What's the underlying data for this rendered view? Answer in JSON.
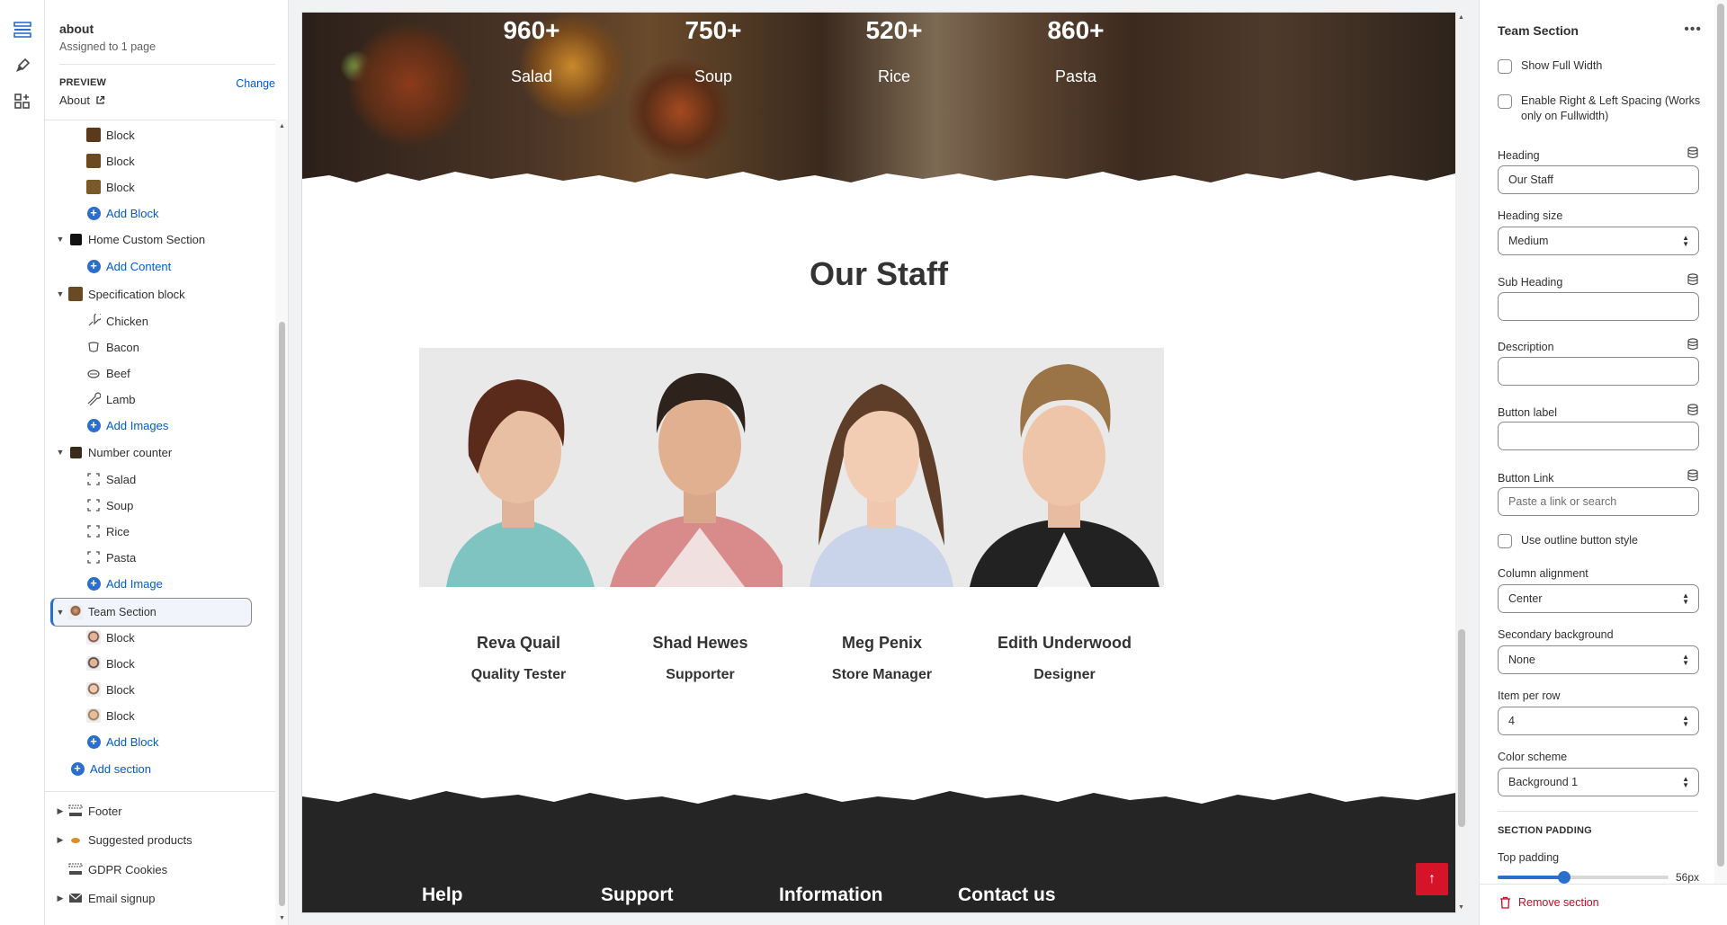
{
  "template": {
    "name": "about",
    "assigned": "Assigned to 1 page"
  },
  "preview_info": {
    "label": "PREVIEW",
    "change": "Change",
    "page": "About"
  },
  "tree": {
    "block_label": "Block",
    "add_block": "Add Block",
    "home_custom": "Home Custom Section",
    "add_content": "Add Content",
    "specification": "Specification block",
    "spec_items": [
      "Chicken",
      "Bacon",
      "Beef",
      "Lamb"
    ],
    "add_images": "Add Images",
    "number_counter": "Number counter",
    "counter_items": [
      "Salad",
      "Soup",
      "Rice",
      "Pasta"
    ],
    "add_image": "Add Image",
    "team_section": "Team Section",
    "add_section": "Add section",
    "footer": "Footer",
    "suggested": "Suggested products",
    "gdpr": "GDPR Cookies",
    "email": "Email signup"
  },
  "preview": {
    "stats": [
      {
        "num": "960+",
        "cap": "Salad"
      },
      {
        "num": "750+",
        "cap": "Soup"
      },
      {
        "num": "520+",
        "cap": "Rice"
      },
      {
        "num": "860+",
        "cap": "Pasta"
      }
    ],
    "staff_title": "Our Staff",
    "staff": [
      {
        "name": "Reva Quail",
        "role": "Quality Tester"
      },
      {
        "name": "Shad Hewes",
        "role": "Supporter"
      },
      {
        "name": "Meg Penix",
        "role": "Store Manager"
      },
      {
        "name": "Edith Underwood",
        "role": "Designer"
      }
    ],
    "footer_cols": [
      "Help",
      "Support",
      "Information",
      "Contact us"
    ]
  },
  "panel": {
    "title": "Team Section",
    "more": "•••",
    "show_full_width": "Show Full Width",
    "enable_spacing": "Enable Right & Left Spacing (Works only on Fullwidth)",
    "heading_label": "Heading",
    "heading_value": "Our Staff",
    "heading_size_label": "Heading size",
    "heading_size_value": "Medium",
    "sub_heading_label": "Sub Heading",
    "description_label": "Description",
    "button_label_label": "Button label",
    "button_link_label": "Button Link",
    "button_link_placeholder": "Paste a link or search",
    "outline_label": "Use outline button style",
    "col_align_label": "Column alignment",
    "col_align_value": "Center",
    "sec_bg_label": "Secondary background",
    "sec_bg_value": "None",
    "item_per_row_label": "Item per row",
    "item_per_row_value": "4",
    "color_scheme_label": "Color scheme",
    "color_scheme_value": "Background 1",
    "section_padding": "SECTION PADDING",
    "top_padding_label": "Top padding",
    "top_padding_value": "56px",
    "top_padding_fraction": 0.39,
    "remove": "Remove section"
  },
  "colors": {
    "accent": "#2c6ecb",
    "danger": "#c70a24",
    "scroll_top": "#d5142a"
  }
}
